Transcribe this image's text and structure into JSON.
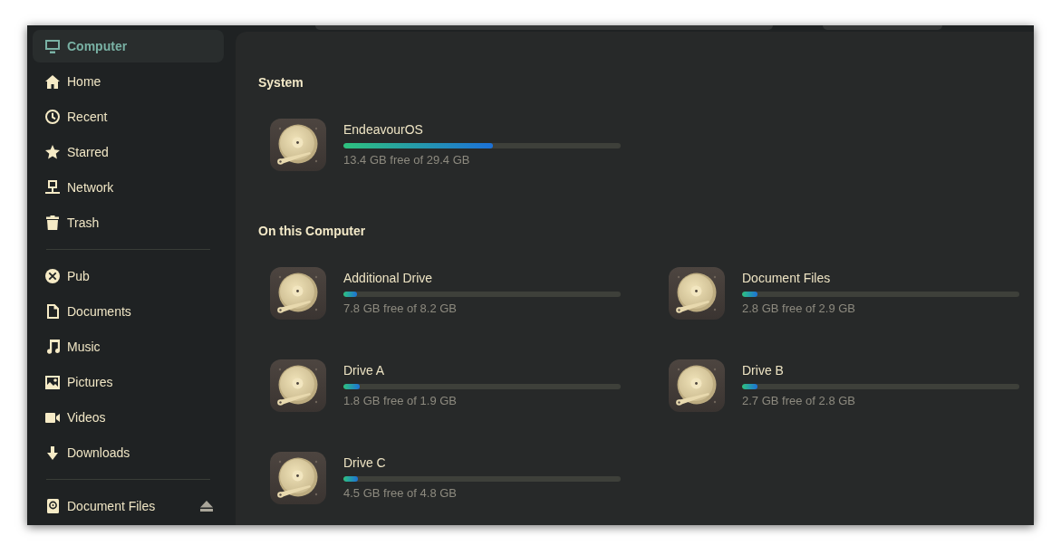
{
  "sidebar": {
    "groups": [
      {
        "items": [
          {
            "label": "Computer",
            "kind": "computer",
            "selected": true,
            "ejectable": false
          },
          {
            "label": "Home",
            "kind": "home",
            "selected": false,
            "ejectable": false
          },
          {
            "label": "Recent",
            "kind": "recent",
            "selected": false,
            "ejectable": false
          },
          {
            "label": "Starred",
            "kind": "starred",
            "selected": false,
            "ejectable": false
          },
          {
            "label": "Network",
            "kind": "network",
            "selected": false,
            "ejectable": false
          },
          {
            "label": "Trash",
            "kind": "trash",
            "selected": false,
            "ejectable": false
          }
        ]
      },
      {
        "items": [
          {
            "label": "Pub",
            "kind": "share",
            "selected": false,
            "ejectable": false
          },
          {
            "label": "Documents",
            "kind": "documents",
            "selected": false,
            "ejectable": false
          },
          {
            "label": "Music",
            "kind": "music",
            "selected": false,
            "ejectable": false
          },
          {
            "label": "Pictures",
            "kind": "pictures",
            "selected": false,
            "ejectable": false
          },
          {
            "label": "Videos",
            "kind": "videos",
            "selected": false,
            "ejectable": false
          },
          {
            "label": "Downloads",
            "kind": "downloads",
            "selected": false,
            "ejectable": false
          }
        ]
      },
      {
        "items": [
          {
            "label": "Document Files",
            "kind": "volume",
            "selected": false,
            "ejectable": true
          }
        ]
      }
    ]
  },
  "main": {
    "sections": [
      {
        "title": "System",
        "drives": [
          {
            "name": "EndeavourOS",
            "level": 0.54,
            "usage": "13.4 GB free of 29.4 GB"
          }
        ]
      },
      {
        "title": "On this Computer",
        "drives": [
          {
            "name": "Additional Drive",
            "level": 0.05,
            "usage": "7.8 GB free of 8.2 GB"
          },
          {
            "name": "Document Files",
            "level": 0.055,
            "usage": "2.8 GB free of 2.9 GB"
          },
          {
            "name": "Drive A",
            "level": 0.06,
            "usage": "1.8 GB free of 1.9 GB"
          },
          {
            "name": "Drive B",
            "level": 0.055,
            "usage": "2.7 GB free of 2.8 GB"
          },
          {
            "name": "Drive C",
            "level": 0.052,
            "usage": "4.5 GB free of 4.8 GB"
          }
        ]
      }
    ]
  }
}
